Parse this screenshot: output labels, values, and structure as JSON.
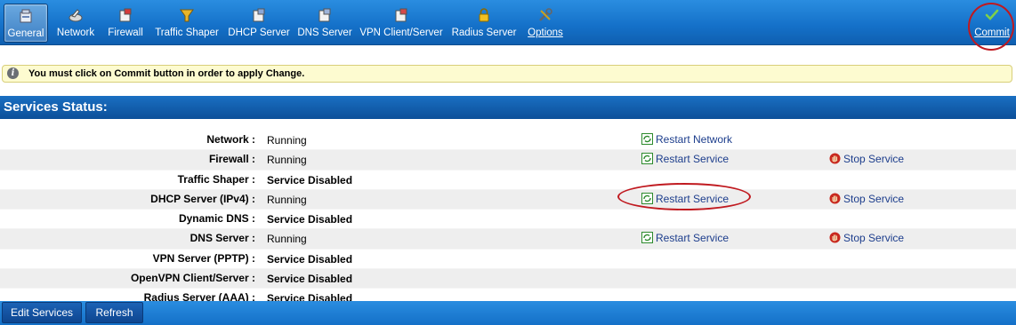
{
  "toolbar": {
    "items": [
      {
        "label": "General",
        "icon": "general-icon",
        "active": true
      },
      {
        "label": "Network",
        "icon": "network-icon"
      },
      {
        "label": "Firewall",
        "icon": "firewall-icon"
      },
      {
        "label": "Traffic Shaper",
        "icon": "traffic-shaper-icon"
      },
      {
        "label": "DHCP Server",
        "icon": "dhcp-server-icon"
      },
      {
        "label": "DNS Server",
        "icon": "dns-server-icon"
      },
      {
        "label": "VPN Client/Server",
        "icon": "vpn-icon"
      },
      {
        "label": "Radius Server",
        "icon": "lock-icon"
      },
      {
        "label": "Options",
        "icon": "tools-icon"
      }
    ],
    "commit_label": "Commit",
    "commit_icon": "checkmark-icon"
  },
  "notice": {
    "text": "You must click on Commit button in order to apply Change."
  },
  "section_title": "Services Status:",
  "services": [
    {
      "name": "Network",
      "status": "Running",
      "action1": "Restart Network",
      "action2": ""
    },
    {
      "name": "Firewall",
      "status": "Running",
      "action1": "Restart Service",
      "action2": "Stop Service"
    },
    {
      "name": "Traffic Shaper",
      "status": "Service Disabled",
      "action1": "",
      "action2": ""
    },
    {
      "name": "DHCP Server (IPv4)",
      "status": "Running",
      "action1": "Restart Service",
      "action2": "Stop Service"
    },
    {
      "name": "Dynamic DNS",
      "status": "Service Disabled",
      "action1": "",
      "action2": ""
    },
    {
      "name": "DNS Server",
      "status": "Running",
      "action1": "Restart Service",
      "action2": "Stop Service"
    },
    {
      "name": "VPN Server (PPTP)",
      "status": "Service Disabled",
      "action1": "",
      "action2": ""
    },
    {
      "name": "OpenVPN Client/Server",
      "status": "Service Disabled",
      "action1": "",
      "action2": ""
    },
    {
      "name": "Radius Server (AAA)",
      "status": "Service Disabled",
      "action1": "",
      "action2": ""
    }
  ],
  "separator": ":",
  "buttons": {
    "edit_services": "Edit Services",
    "refresh": "Refresh"
  },
  "colors": {
    "toolbar": "#1470c8",
    "link": "#1c3d8c",
    "highlight_ring": "#c0191f",
    "notice_bg": "#fdfbd0"
  }
}
